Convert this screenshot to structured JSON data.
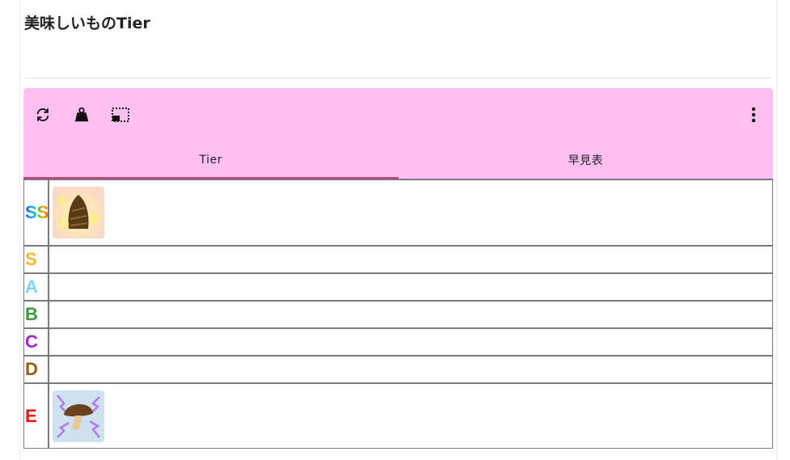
{
  "page": {
    "title": "美味しいものTier"
  },
  "toolbar": {
    "icons": [
      "sync-icon",
      "weight-icon",
      "picture-in-picture-icon",
      "more-vert-icon"
    ],
    "tabs": [
      {
        "label": "Tier",
        "active": true
      },
      {
        "label": "早見表",
        "active": false
      }
    ],
    "accent": "#ffc0f1",
    "active_tab_underline": "#c2407e"
  },
  "tiers": [
    {
      "label": "SS",
      "color": "rainbow",
      "items": [
        "sparkling-bamboo-shoot"
      ]
    },
    {
      "label": "S",
      "color": "#f5b82e",
      "items": []
    },
    {
      "label": "A",
      "color": "#7fd2f2",
      "items": []
    },
    {
      "label": "B",
      "color": "#3a9a3a",
      "items": []
    },
    {
      "label": "C",
      "color": "#aa22cc",
      "items": []
    },
    {
      "label": "D",
      "color": "#9a5a14",
      "items": []
    },
    {
      "label": "E",
      "color": "#ee1111",
      "items": [
        "electric-mushroom"
      ]
    }
  ]
}
